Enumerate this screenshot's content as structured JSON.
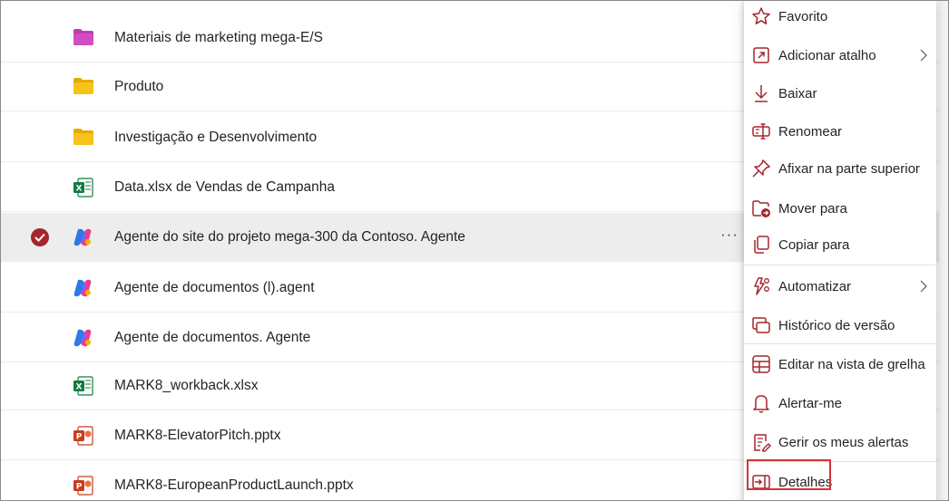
{
  "files": [
    {
      "name": "Materiais de marketing mega-E/S",
      "icon": "folder-magenta-icon"
    },
    {
      "name": "Produto",
      "icon": "folder-icon"
    },
    {
      "name": "Investigação e Desenvolvimento",
      "icon": "folder-icon"
    },
    {
      "name": "Data.xlsx de Vendas de Campanha",
      "icon": "excel-icon"
    },
    {
      "name": "Agente do site do projeto mega-300 da Contoso. Agente",
      "icon": "copilot-agent-icon",
      "selected": true,
      "more": "···"
    },
    {
      "name": "Agente de documentos (l).agent",
      "icon": "copilot-agent-icon"
    },
    {
      "name": "Agente de documentos. Agente",
      "icon": "copilot-agent-icon"
    },
    {
      "name": "MARK8_workback.xlsx",
      "icon": "excel-icon"
    },
    {
      "name": "MARK8-ElevatorPitch.pptx",
      "icon": "powerpoint-icon"
    },
    {
      "name": "MARK8-EuropeanProductLaunch.pptx",
      "icon": "powerpoint-icon"
    }
  ],
  "menu": {
    "items": [
      {
        "label": "Favorito",
        "icon": "star-icon"
      },
      {
        "label": "Adicionar atalho",
        "icon": "shortcut-icon",
        "submenu": true
      },
      {
        "label": "Baixar",
        "icon": "download-icon"
      },
      {
        "label": "Renomear",
        "icon": "rename-icon"
      },
      {
        "label": "Afixar na parte superior",
        "icon": "pin-icon"
      },
      {
        "label": "Mover para",
        "icon": "move-to-folder-icon"
      },
      {
        "label": "Copiar para",
        "icon": "copy-icon"
      },
      {
        "label": "Automatizar",
        "icon": "automate-icon",
        "submenu": true
      },
      {
        "label": "Histórico de versão",
        "icon": "version-history-icon"
      },
      {
        "label": "Editar na vista de grelha",
        "icon": "grid-view-icon"
      },
      {
        "label": "Alertar-me",
        "icon": "bell-icon"
      },
      {
        "label": "Gerir os meus alertas",
        "icon": "manage-alerts-icon"
      },
      {
        "label": "Detalhes",
        "icon": "details-icon",
        "highlighted": true
      }
    ]
  },
  "colors": {
    "accent": "#a4262c",
    "highlight_border": "#d13438",
    "folder": "#f2b700",
    "folder_magenta": "#c239b3",
    "excel": "#107c41",
    "powerpoint": "#c43e1c"
  }
}
